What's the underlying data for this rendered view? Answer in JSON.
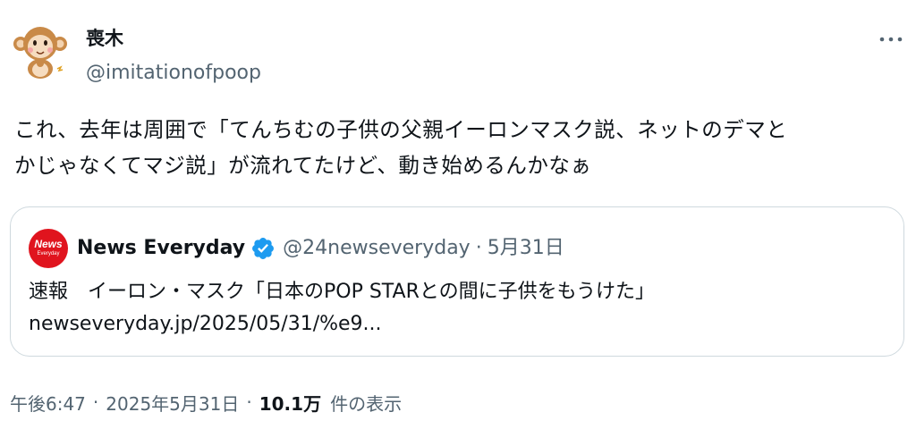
{
  "author": {
    "name": "喪木",
    "handle": "@imitationofpoop"
  },
  "tweet": {
    "text_lines": [
      "これ、去年は周囲で「てんちむの子供の父親イーロンマスク説、ネットのデマと",
      "かじゃなくてマジ説」が流れてたけど、動き始めるんかなぁ"
    ]
  },
  "quote": {
    "avatar_text": "News",
    "avatar_subtext": "Everyday",
    "name": "News Everyday",
    "handle": "@24newseveryday",
    "separator": "·",
    "date": "5月31日",
    "text_lines": [
      "速報　イーロン・マスク「日本のPOP STARとの間に子供をもうけた」",
      "newseveryday.jp/2025/05/31/%e9..."
    ]
  },
  "meta": {
    "time": "午後6:47",
    "separator": "·",
    "date": "2025年5月31日",
    "views": "10.1万",
    "views_label": "件の表示"
  },
  "icons": {
    "more": "more-horizontal-icon",
    "verified": "verified-badge-icon"
  },
  "colors": {
    "text_primary": "#0f1419",
    "text_secondary": "#536471",
    "border": "#cfd9de",
    "verified_blue": "#1d9bf0",
    "news_red": "#e0141e"
  }
}
